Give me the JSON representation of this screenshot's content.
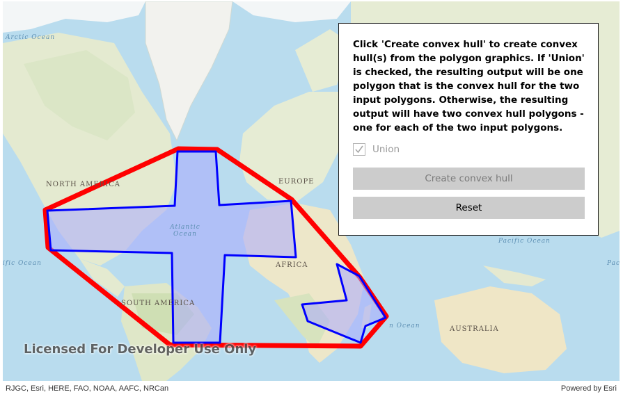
{
  "map": {
    "ocean_labels": [
      "Arctic Ocean",
      "Atlantic Ocean",
      "Pacific Ocean",
      "ific Ocean",
      "Pac",
      "n Ocean"
    ],
    "land_labels": [
      "NORTH AMERICA",
      "EUROPE",
      "AFRICA",
      "SOUTH AMERICA",
      "AUSTRALIA"
    ],
    "watermark": "Licensed For Developer Use Only",
    "attribution": "RJGC, Esri, HERE, FAO, NOAA, AAFC, NRCan",
    "powered_by": "Powered by Esri",
    "colors": {
      "hull_stroke": "#ff0000",
      "polygon_stroke": "#0000ff",
      "polygon_fill": "rgba(170,170,255,0.55)",
      "ocean": "#b9dcee",
      "land": "#e7ecd6"
    }
  },
  "panel": {
    "instructions": "Click 'Create convex hull' to create convex hull(s) from the polygon graphics. If 'Union' is checked, the resulting output will be one polygon that is the convex hull for the two input polygons. Otherwise, the resulting output will have two convex hull polygons - one for each of the two input polygons.",
    "union_label": "Union",
    "union_checked": true,
    "union_enabled": false,
    "create_button_label": "Create convex hull",
    "create_button_enabled": false,
    "reset_button_label": "Reset"
  }
}
